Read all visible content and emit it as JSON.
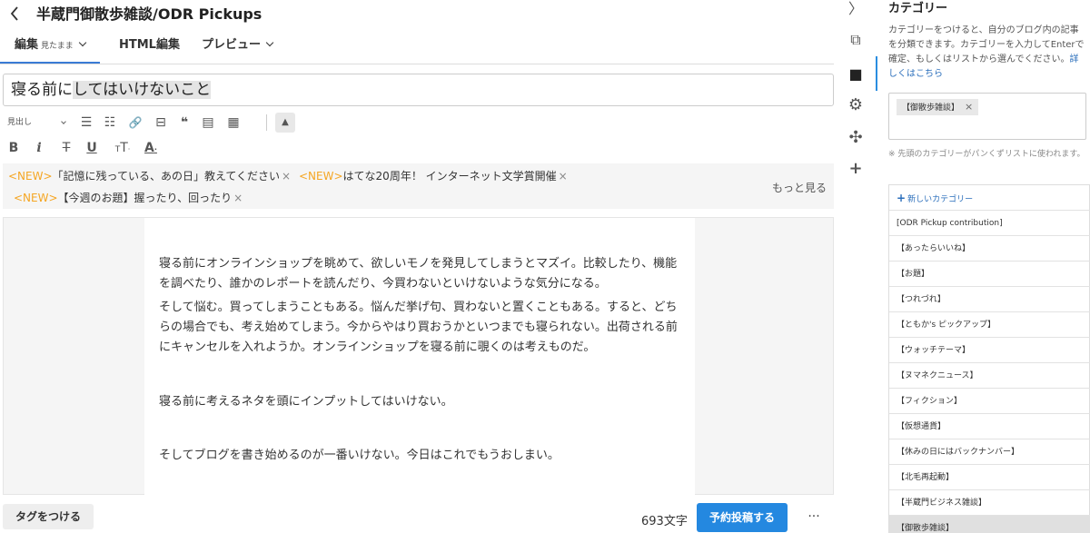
{
  "header": {
    "back_icon": "chevron-left-icon",
    "blog_title": "半蔵門御散歩雑談/ODR Pickups"
  },
  "tabs": {
    "edit": {
      "label": "編集",
      "sub": "見たまま"
    },
    "html": {
      "label": "HTML編集"
    },
    "preview": {
      "label": "プレビュー"
    }
  },
  "post": {
    "title_part1": "寝る前に",
    "title_part2": "してはいけないこと"
  },
  "toolbar": {
    "heading_select": "見出し",
    "row1_icons": [
      "list-bullet-icon",
      "list-number-icon",
      "link-icon",
      "read-more-icon",
      "quote-icon",
      "table-of-contents-icon",
      "footnote-icon"
    ],
    "row2_icons": [
      "bold-icon",
      "italic-icon",
      "strikethrough-icon",
      "underline-icon",
      "font-size-icon",
      "text-color-icon"
    ],
    "glyphs": {
      "list_bullet": "☰",
      "list_number": "☷",
      "link": "🔗",
      "read_more": "⊟",
      "quote": "❝",
      "toc": "▤",
      "footnote": "▦",
      "collapse": "▲",
      "bold": "B",
      "italic": "i",
      "strike": "S̶",
      "underline": "U",
      "font_size": "T",
      "text_color": "A"
    }
  },
  "notices": [
    {
      "tag": "<NEW>",
      "text": "「記憶に残っている、あの日」教えてください",
      "close": "×"
    },
    {
      "tag": "<NEW>",
      "text": "はてな20周年！ インターネット文学賞開催",
      "close": "×"
    },
    {
      "tag": "<NEW>",
      "text": "【今週のお題】握ったり、回ったり",
      "close": "×"
    }
  ],
  "notices_more": "もっと見る",
  "body": {
    "paragraphs": [
      "寝る前にオンラインショップを眺めて、欲しいモノを発見してしまうとマズイ。比較したり、機能を調べたり、誰かのレポートを読んだり、今買わないといけないような気分になる。",
      "そして悩む。買ってしまうこともある。悩んだ挙げ句、買わないと置くこともある。すると、どちらの場合でも、考え始めてしまう。今からやはり買おうかといつまでも寝られない。出荷される前にキャンセルを入れようか。オンラインショップを寝る前に覗くのは考えものだ。",
      "寝る前に考えるネタを頭にインプットしてはいけない。",
      "そしてブログを書き始めるのが一番いけない。今日はこれでもうおしまい。"
    ]
  },
  "footer": {
    "tag_button": "タグをつける",
    "char_count": "693文字",
    "publish_button": "予約投稿する",
    "more": "···"
  },
  "rail": {
    "icons": [
      "chevron-right-icon",
      "photo-icon",
      "folder-icon",
      "gear-icon",
      "pinwheel-icon",
      "plus-icon"
    ],
    "glyphs": [
      "〉",
      "⧉",
      "■",
      "⚙",
      "✣",
      "+"
    ]
  },
  "sidebar": {
    "title": "カテゴリー",
    "description": "カテゴリーをつけると、自分のブログ内の記事を分類できます。カテゴリーを入力してEnterで確定、もしくはリストから選んでください。",
    "description_link": "詳しくはこちら",
    "selected_chip": "【御散歩雑談】",
    "chip_close": "×",
    "note": "※ 先頭のカテゴリーがパンくずリストに使われます。",
    "new_category": "新しいカテゴリー",
    "categories": [
      "[ODR Pickup contribution]",
      "【あったらいいね】",
      "【お題】",
      "【つれづれ】",
      "【ともか's ピックアップ】",
      "【ウォッチテーマ】",
      "【ヌマネクニュース】",
      "【フィクション】",
      "【仮想通貨】",
      "【休みの日にはバックナンバー】",
      "【北毛再起動】",
      "【半蔵門ビジネス雑談】",
      "【御散歩雑談】"
    ]
  }
}
